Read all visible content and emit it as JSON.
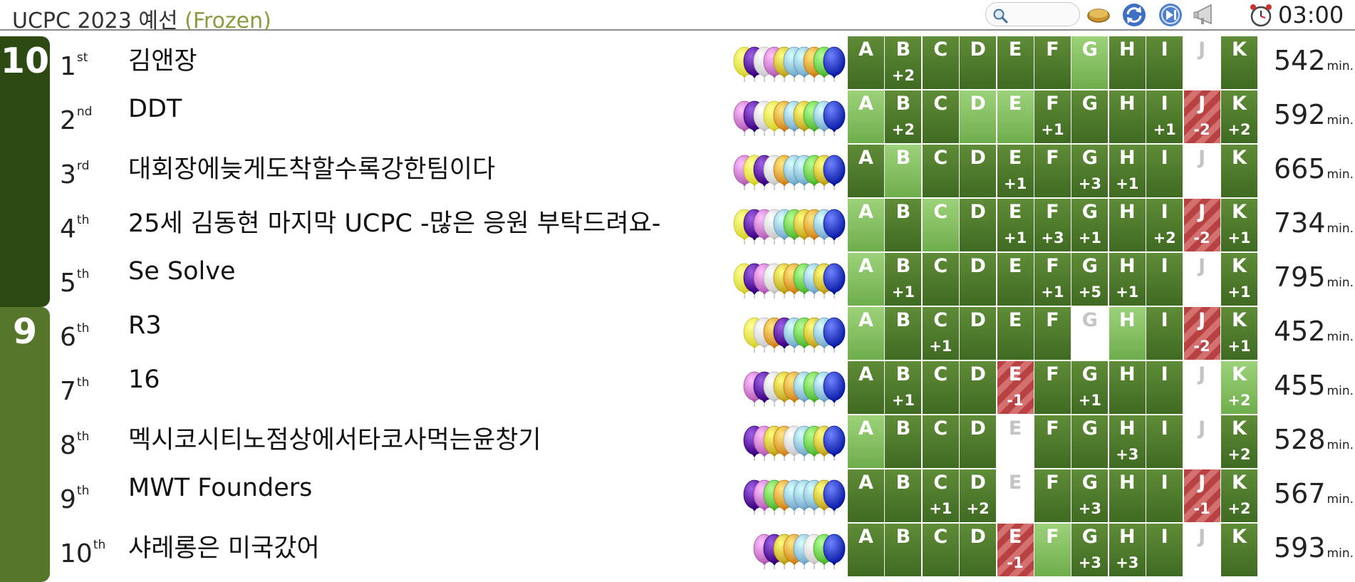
{
  "header": {
    "title": "UCPC 2023 예선",
    "status": "(Frozen)",
    "search_placeholder": "",
    "clock": "03:00",
    "icons": [
      "search-icon",
      "pie-icon",
      "refresh-icon",
      "skip-next-icon",
      "megaphone-icon",
      "alarm-clock-icon"
    ]
  },
  "colors": {
    "group_10": "#2d4a12",
    "group_9": "#56772a",
    "solved": "#4a7a2c",
    "first_solve": "#86c063",
    "pending": "#c45555",
    "balloon_palette": {
      "Y": "#f7f24e",
      "P": "#5a1ba0",
      "W": "#e9e9e9",
      "M": "#d77dd7",
      "G": "#dfc23a",
      "L": "#92c8ea",
      "O": "#f2a33a",
      "N": "#6ed74f",
      "B": "#2a3dc6"
    }
  },
  "problems": [
    "A",
    "B",
    "C",
    "D",
    "E",
    "F",
    "G",
    "H",
    "I",
    "J",
    "K"
  ],
  "groups": [
    {
      "label": "10"
    },
    {
      "label": "9"
    }
  ],
  "teams": [
    {
      "rank": "1",
      "suffix": "st",
      "name": "김앤장",
      "penalty": "542",
      "unit": "min.",
      "balloons": [
        "Y",
        "P",
        "W",
        "M",
        "G",
        "L",
        "L",
        "O",
        "N",
        "B"
      ],
      "cells": [
        [
          "solved",
          ""
        ],
        [
          "solved",
          "+2"
        ],
        [
          "solved",
          ""
        ],
        [
          "solved",
          ""
        ],
        [
          "solved",
          ""
        ],
        [
          "solved",
          ""
        ],
        [
          "first",
          ""
        ],
        [
          "solved",
          ""
        ],
        [
          "solved",
          ""
        ],
        [
          "empty",
          ""
        ],
        [
          "solved",
          ""
        ]
      ]
    },
    {
      "rank": "2",
      "suffix": "nd",
      "name": "DDT",
      "penalty": "592",
      "unit": "min.",
      "balloons": [
        "M",
        "P",
        "W",
        "Y",
        "O",
        "L",
        "G",
        "N",
        "L",
        "B"
      ],
      "cells": [
        [
          "first",
          ""
        ],
        [
          "solved",
          "+2"
        ],
        [
          "solved",
          ""
        ],
        [
          "first",
          ""
        ],
        [
          "first",
          ""
        ],
        [
          "solved",
          "+1"
        ],
        [
          "solved",
          ""
        ],
        [
          "solved",
          ""
        ],
        [
          "solved",
          "+1"
        ],
        [
          "pending",
          "-2"
        ],
        [
          "solved",
          "+2"
        ]
      ]
    },
    {
      "rank": "3",
      "suffix": "rd",
      "name": "대회장에늦게도착할수록강한팀이다",
      "penalty": "665",
      "unit": "min.",
      "balloons": [
        "M",
        "Y",
        "P",
        "W",
        "O",
        "L",
        "L",
        "N",
        "G",
        "B"
      ],
      "cells": [
        [
          "solved",
          ""
        ],
        [
          "first",
          ""
        ],
        [
          "solved",
          ""
        ],
        [
          "solved",
          ""
        ],
        [
          "solved",
          "+1"
        ],
        [
          "solved",
          ""
        ],
        [
          "solved",
          "+3"
        ],
        [
          "solved",
          "+1"
        ],
        [
          "solved",
          ""
        ],
        [
          "empty",
          ""
        ],
        [
          "solved",
          ""
        ]
      ]
    },
    {
      "rank": "4",
      "suffix": "th",
      "name": "25세 김동현 마지막 UCPC -많은 응원 부탁드려요-",
      "penalty": "734",
      "unit": "min.",
      "balloons": [
        "Y",
        "P",
        "M",
        "W",
        "L",
        "N",
        "G",
        "O",
        "L",
        "B"
      ],
      "cells": [
        [
          "first",
          ""
        ],
        [
          "solved",
          ""
        ],
        [
          "first",
          ""
        ],
        [
          "solved",
          ""
        ],
        [
          "solved",
          "+1"
        ],
        [
          "solved",
          "+3"
        ],
        [
          "solved",
          "+1"
        ],
        [
          "solved",
          ""
        ],
        [
          "solved",
          "+2"
        ],
        [
          "pending",
          "-2"
        ],
        [
          "solved",
          "+1"
        ]
      ]
    },
    {
      "rank": "5",
      "suffix": "th",
      "name": "Se Solve",
      "penalty": "795",
      "unit": "min.",
      "balloons": [
        "Y",
        "P",
        "M",
        "W",
        "G",
        "O",
        "N",
        "L",
        "G",
        "B"
      ],
      "cells": [
        [
          "first",
          ""
        ],
        [
          "solved",
          "+1"
        ],
        [
          "solved",
          ""
        ],
        [
          "solved",
          ""
        ],
        [
          "solved",
          ""
        ],
        [
          "solved",
          "+1"
        ],
        [
          "solved",
          "+5"
        ],
        [
          "solved",
          "+1"
        ],
        [
          "solved",
          ""
        ],
        [
          "empty",
          ""
        ],
        [
          "solved",
          "+1"
        ]
      ]
    },
    {
      "rank": "6",
      "suffix": "th",
      "name": "R3",
      "penalty": "452",
      "unit": "min.",
      "balloons": [
        "Y",
        "W",
        "O",
        "P",
        "L",
        "N",
        "G",
        "L",
        "B"
      ],
      "cells": [
        [
          "first",
          ""
        ],
        [
          "solved",
          ""
        ],
        [
          "solved",
          "+1"
        ],
        [
          "solved",
          ""
        ],
        [
          "solved",
          ""
        ],
        [
          "solved",
          ""
        ],
        [
          "empty",
          ""
        ],
        [
          "first",
          ""
        ],
        [
          "solved",
          ""
        ],
        [
          "pending",
          "-2"
        ],
        [
          "solved",
          "+1"
        ]
      ]
    },
    {
      "rank": "7",
      "suffix": "th",
      "name": "16",
      "penalty": "455",
      "unit": "min.",
      "balloons": [
        "M",
        "P",
        "W",
        "G",
        "O",
        "L",
        "N",
        "L",
        "B"
      ],
      "cells": [
        [
          "solved",
          ""
        ],
        [
          "solved",
          "+1"
        ],
        [
          "solved",
          ""
        ],
        [
          "solved",
          ""
        ],
        [
          "pending",
          "-1"
        ],
        [
          "solved",
          ""
        ],
        [
          "solved",
          "+1"
        ],
        [
          "solved",
          ""
        ],
        [
          "solved",
          ""
        ],
        [
          "empty",
          ""
        ],
        [
          "first",
          "+2"
        ]
      ]
    },
    {
      "rank": "8",
      "suffix": "th",
      "name": "멕시코시티노점상에서타코사먹는윤창기",
      "penalty": "528",
      "unit": "min.",
      "balloons": [
        "P",
        "M",
        "G",
        "O",
        "W",
        "L",
        "N",
        "G",
        "B"
      ],
      "cells": [
        [
          "first",
          ""
        ],
        [
          "solved",
          ""
        ],
        [
          "solved",
          ""
        ],
        [
          "solved",
          ""
        ],
        [
          "empty",
          ""
        ],
        [
          "solved",
          ""
        ],
        [
          "solved",
          ""
        ],
        [
          "solved",
          "+3"
        ],
        [
          "solved",
          ""
        ],
        [
          "empty",
          ""
        ],
        [
          "solved",
          "+2"
        ]
      ]
    },
    {
      "rank": "9",
      "suffix": "th",
      "name": "MWT Founders",
      "penalty": "567",
      "unit": "min.",
      "balloons": [
        "P",
        "M",
        "N",
        "O",
        "L",
        "L",
        "L",
        "G",
        "B"
      ],
      "cells": [
        [
          "solved",
          ""
        ],
        [
          "solved",
          ""
        ],
        [
          "solved",
          "+1"
        ],
        [
          "solved",
          "+2"
        ],
        [
          "empty",
          ""
        ],
        [
          "solved",
          ""
        ],
        [
          "solved",
          "+3"
        ],
        [
          "solved",
          ""
        ],
        [
          "solved",
          ""
        ],
        [
          "pending",
          "-1"
        ],
        [
          "solved",
          "+2"
        ]
      ]
    },
    {
      "rank": "10",
      "suffix": "th",
      "name": "샤레롱은 미국갔어",
      "penalty": "593",
      "unit": "min.",
      "balloons": [
        "M",
        "P",
        "G",
        "O",
        "L",
        "W",
        "N",
        "B"
      ],
      "cells": [
        [
          "solved",
          ""
        ],
        [
          "solved",
          ""
        ],
        [
          "solved",
          ""
        ],
        [
          "solved",
          ""
        ],
        [
          "pending",
          "-1"
        ],
        [
          "first",
          ""
        ],
        [
          "solved",
          "+3"
        ],
        [
          "solved",
          "+3"
        ],
        [
          "solved",
          ""
        ],
        [
          "empty",
          ""
        ],
        [
          "solved",
          ""
        ]
      ]
    }
  ]
}
